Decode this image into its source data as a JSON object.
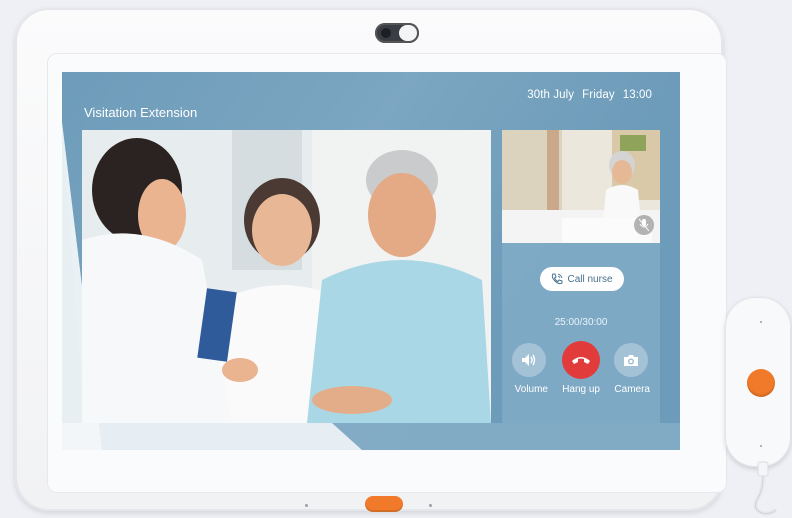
{
  "screen": {
    "title": "Visitation Extension",
    "date": "30th July",
    "day": "Friday",
    "time": "13:00"
  },
  "side_panel": {
    "call_nurse_label": "Call nurse",
    "timer": "25:00/30:00",
    "controls": [
      {
        "label": "Volume",
        "icon": "speaker-icon"
      },
      {
        "label": "Hang up",
        "icon": "phone-hangup-icon"
      },
      {
        "label": "Camera",
        "icon": "camera-icon"
      }
    ]
  },
  "colors": {
    "screen_bg": "#6d9cba",
    "hangup_red": "#e23b3b",
    "accent_orange": "#f07a2a"
  }
}
